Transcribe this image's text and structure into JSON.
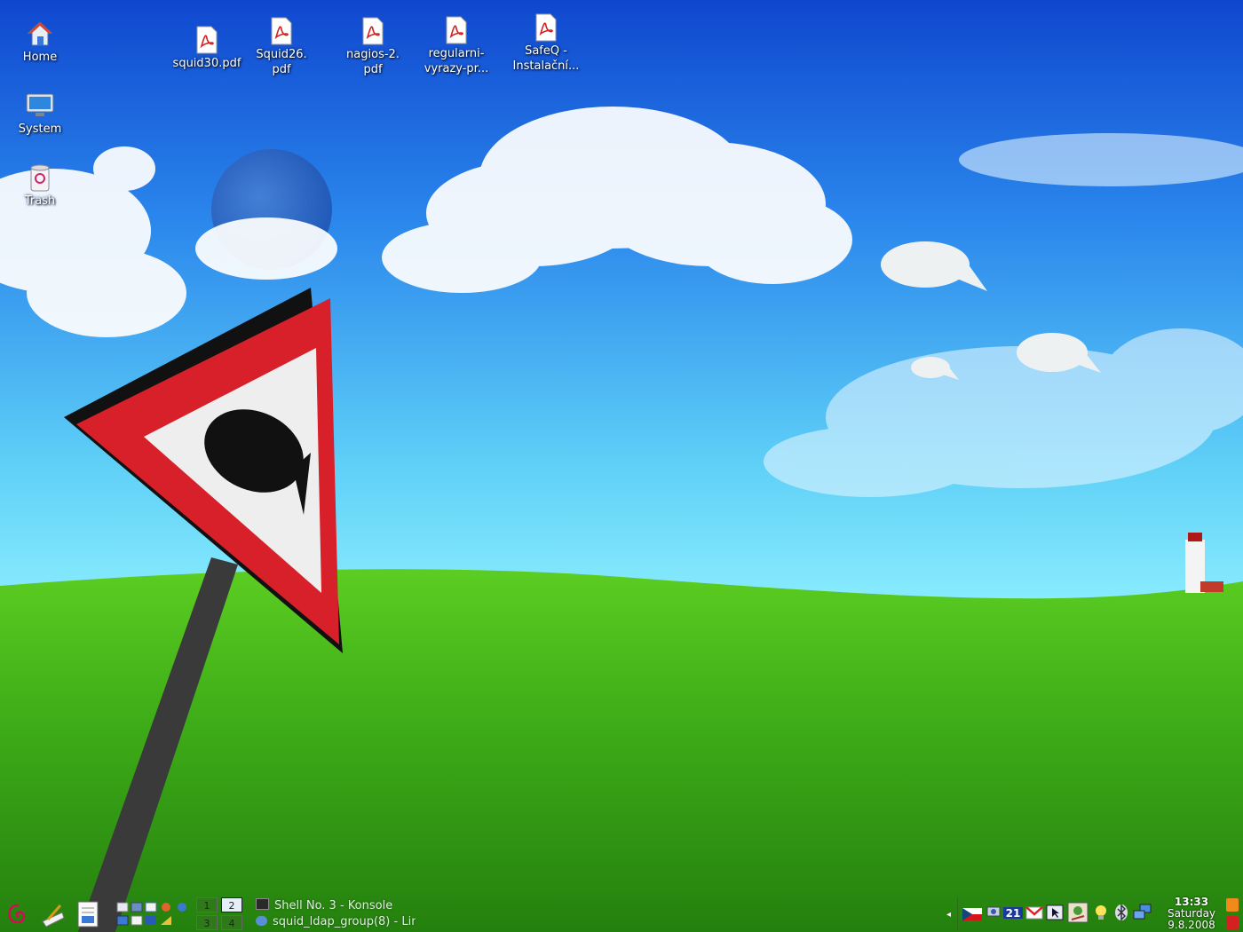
{
  "desktop_icons": [
    {
      "id": "home",
      "lines": [
        "Home"
      ],
      "icon": "home-folder-icon"
    },
    {
      "id": "system",
      "lines": [
        "System"
      ],
      "icon": "monitor-icon"
    },
    {
      "id": "trash",
      "lines": [
        "Trash"
      ],
      "icon": "trash-icon"
    },
    {
      "id": "squid30",
      "lines": [
        "squid30.pdf"
      ],
      "icon": "pdf-file-icon"
    },
    {
      "id": "squid26",
      "lines": [
        "Squid26.",
        "pdf"
      ],
      "icon": "pdf-file-icon"
    },
    {
      "id": "nagios",
      "lines": [
        "nagios-2.",
        "pdf"
      ],
      "icon": "pdf-file-icon"
    },
    {
      "id": "regularni",
      "lines": [
        "regularni-",
        "vyrazy-pr..."
      ],
      "icon": "pdf-file-icon"
    },
    {
      "id": "safeq",
      "lines": [
        "SafeQ -",
        "Instalační..."
      ],
      "icon": "pdf-file-icon"
    }
  ],
  "taskbar": {
    "pager": [
      "1",
      "2",
      "3",
      "4"
    ],
    "active_desktop": "2",
    "tasks": [
      "Shell No. 3 - Konsole",
      "squid_ldap_group(8) - Lin"
    ],
    "tray": {
      "keyboard_layout": "CZ",
      "counter": "21"
    },
    "clock": {
      "time": "13:33",
      "day": "Saturday",
      "date": "9.8.2008"
    }
  },
  "colors": {
    "sky_top": "#1552d6",
    "sky_mid": "#2f8ff0",
    "horizon": "#7fe3fb",
    "grass_light": "#4fc21e",
    "grass_dark": "#1f7a10",
    "sign_red": "#d8202a"
  }
}
